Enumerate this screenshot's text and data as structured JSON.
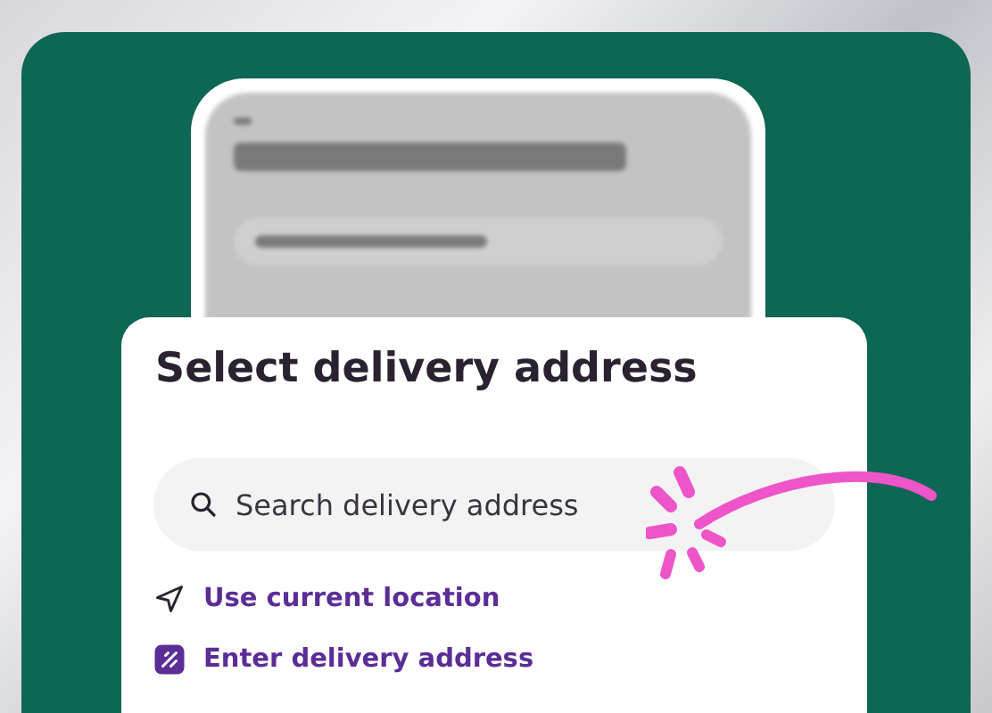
{
  "sheet": {
    "title": "Select delivery address",
    "search": {
      "placeholder": "Search delivery address"
    },
    "options": [
      {
        "kind": "location",
        "label": "Use current location"
      },
      {
        "kind": "manual",
        "label": "Enter delivery address"
      }
    ]
  }
}
